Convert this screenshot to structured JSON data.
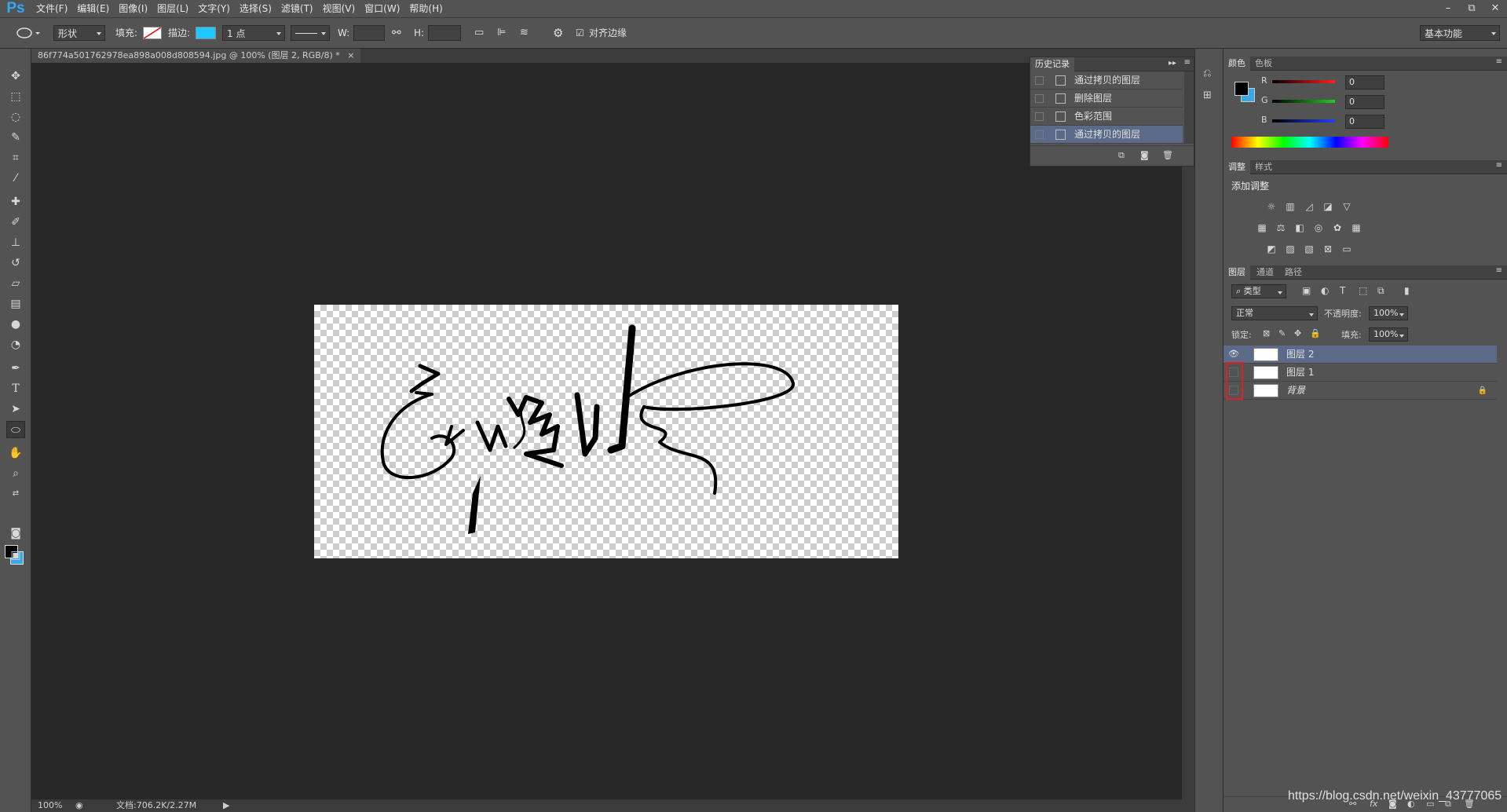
{
  "app": {
    "logo": "Ps",
    "window_buttons": [
      "–",
      "⧉",
      "✕"
    ]
  },
  "menu": [
    "文件(F)",
    "编辑(E)",
    "图像(I)",
    "图层(L)",
    "文字(Y)",
    "选择(S)",
    "滤镜(T)",
    "视图(V)",
    "窗口(W)",
    "帮助(H)"
  ],
  "options": {
    "shape_mode": "形状",
    "fill_label": "填充:",
    "stroke_label": "描边:",
    "stroke_width": "1 点",
    "w_label": "W:",
    "h_label": "H:",
    "align_edges": "对齐边缘",
    "workspace": "基本功能",
    "stroke_color": "#1ec8ff"
  },
  "document": {
    "tab": "86f774a501762978ea898a008d808594.jpg @ 100% (图层 2, RGB/8) *",
    "close": "×"
  },
  "status": {
    "zoom": "100%",
    "doc_info": "文档:706.2K/2.27M"
  },
  "history": {
    "title": "历史记录",
    "items": [
      {
        "label": "通过拷贝的图层",
        "selected": false
      },
      {
        "label": "删除图层",
        "selected": false
      },
      {
        "label": "色彩范围",
        "selected": false
      },
      {
        "label": "通过拷贝的图层",
        "selected": true
      }
    ]
  },
  "color_panel": {
    "tabs": [
      "颜色",
      "色板"
    ],
    "channels": [
      {
        "name": "R",
        "value": "0",
        "color": "#ff2020"
      },
      {
        "name": "G",
        "value": "0",
        "color": "#20d020"
      },
      {
        "name": "B",
        "value": "0",
        "color": "#2040ff"
      }
    ]
  },
  "adjustments": {
    "tabs": [
      "调整",
      "样式"
    ],
    "heading": "添加调整"
  },
  "layers": {
    "tabs": [
      "图层",
      "通道",
      "路径"
    ],
    "filter": "类型",
    "blend_mode": "正常",
    "opacity_label": "不透明度:",
    "opacity": "100%",
    "lock_label": "锁定:",
    "fill_label": "填充:",
    "fill": "100%",
    "items": [
      {
        "name": "图层 2",
        "visible": true,
        "selected": true
      },
      {
        "name": "图层 1",
        "visible": false,
        "selected": false
      },
      {
        "name": "背景",
        "visible": false,
        "selected": false,
        "locked": true
      }
    ]
  },
  "watermark": "https://blog.csdn.net/weixin_43777065"
}
